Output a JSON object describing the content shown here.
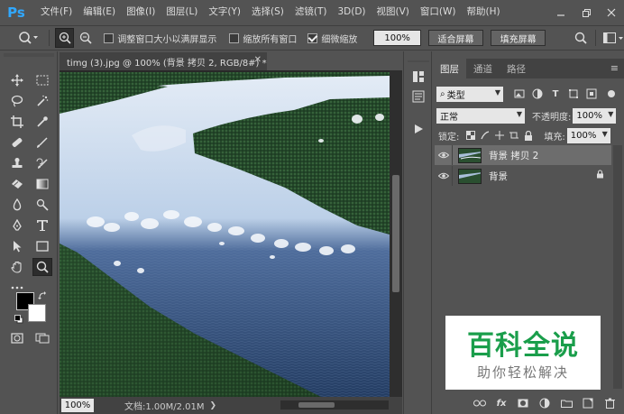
{
  "app": {
    "logo": "Ps"
  },
  "menu": [
    "文件(F)",
    "编辑(E)",
    "图像(I)",
    "图层(L)",
    "文字(Y)",
    "选择(S)",
    "滤镜(T)",
    "3D(D)",
    "视图(V)",
    "窗口(W)",
    "帮助(H)"
  ],
  "options": {
    "resize_windows_label": "调整窗口大小以满屏显示",
    "zoom_all_label": "缩放所有窗口",
    "scrubby_zoom_label": "细微缩放",
    "zoom_value": "100%",
    "fit_screen_label": "适合屏幕",
    "fill_screen_label": "填充屏幕"
  },
  "document": {
    "tab_title": "timg (3).jpg @ 100% (背景 拷贝 2, RGB/8#) *",
    "zoom": "100%",
    "info": "文档:1.00M/2.01M"
  },
  "layers_panel": {
    "tabs": [
      "图层",
      "通道",
      "路径"
    ],
    "filter_kind": "类型",
    "blend_mode": "正常",
    "opacity_label": "不透明度:",
    "opacity_value": "100%",
    "lock_label": "锁定:",
    "fill_label": "填充:",
    "fill_value": "100%",
    "layers": [
      {
        "name": "背景 拷贝 2",
        "selected": true
      },
      {
        "name": "背景",
        "selected": false,
        "locked": true
      }
    ]
  },
  "watermark": {
    "title": "百科全说",
    "subtitle": "助你轻松解决"
  }
}
